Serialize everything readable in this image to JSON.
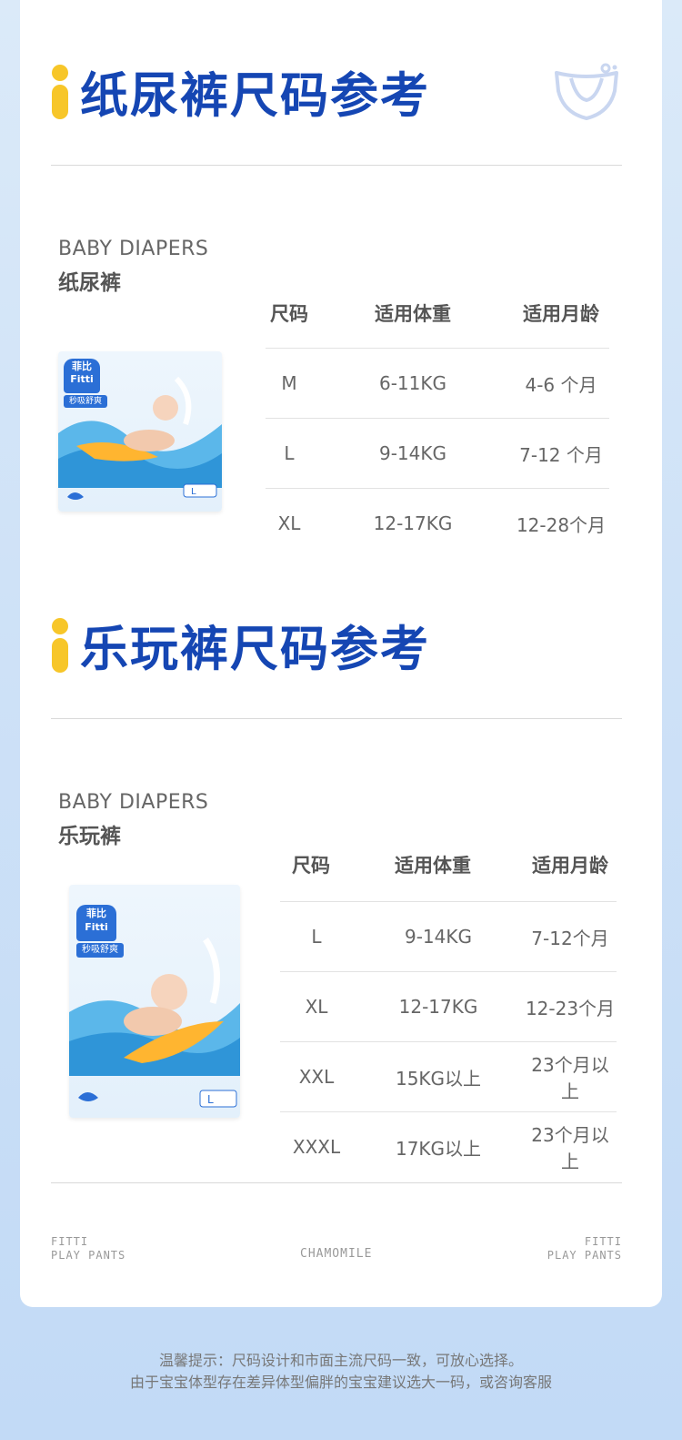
{
  "sections": [
    {
      "title": "纸尿裤尺码参考",
      "sub_en": "BABY DIAPERS",
      "sub_cn": "纸尿裤",
      "headers": [
        "尺码",
        "适用体重",
        "适用月龄"
      ],
      "rows": [
        [
          "M",
          "6-11KG",
          "4-6 个月"
        ],
        [
          "L",
          "9-14KG",
          "7-12 个月"
        ],
        [
          "XL",
          "12-17KG",
          "12-28个月"
        ]
      ]
    },
    {
      "title": "乐玩裤尺码参考",
      "sub_en": "BABY DIAPERS",
      "sub_cn": "乐玩裤",
      "headers": [
        "尺码",
        "适用体重",
        "适用月龄"
      ],
      "rows": [
        [
          "L",
          "9-14KG",
          "7-12个月"
        ],
        [
          "XL",
          "12-17KG",
          "12-23个月"
        ],
        [
          "XXL",
          "15KG以上",
          "23个月以上"
        ],
        [
          "XXXL",
          "17KG以上",
          "23个月以上"
        ]
      ]
    }
  ],
  "product1": {
    "brand_cn": "菲比",
    "brand_en": "Fitti",
    "slogan": "秒吸舒爽",
    "size": "L"
  },
  "product2": {
    "brand_cn": "菲比",
    "brand_en": "Fitti",
    "slogan": "秒吸舒爽",
    "size": "L"
  },
  "footer": {
    "left_line1": "FITTI",
    "left_line2": "PLAY PANTS",
    "center": "CHAMOMILE",
    "right_line1": "FITTI",
    "right_line2": "PLAY PANTS"
  },
  "tip": {
    "line1": "温馨提示：尺码设计和市面主流尺码一致，可放心选择。",
    "line2": "由于宝宝体型存在差异体型偏胖的宝宝建议选大一码，或咨询客服"
  },
  "colors": {
    "title": "#1546b3",
    "accent": "#f7c629",
    "background": "#cfe2f7"
  }
}
